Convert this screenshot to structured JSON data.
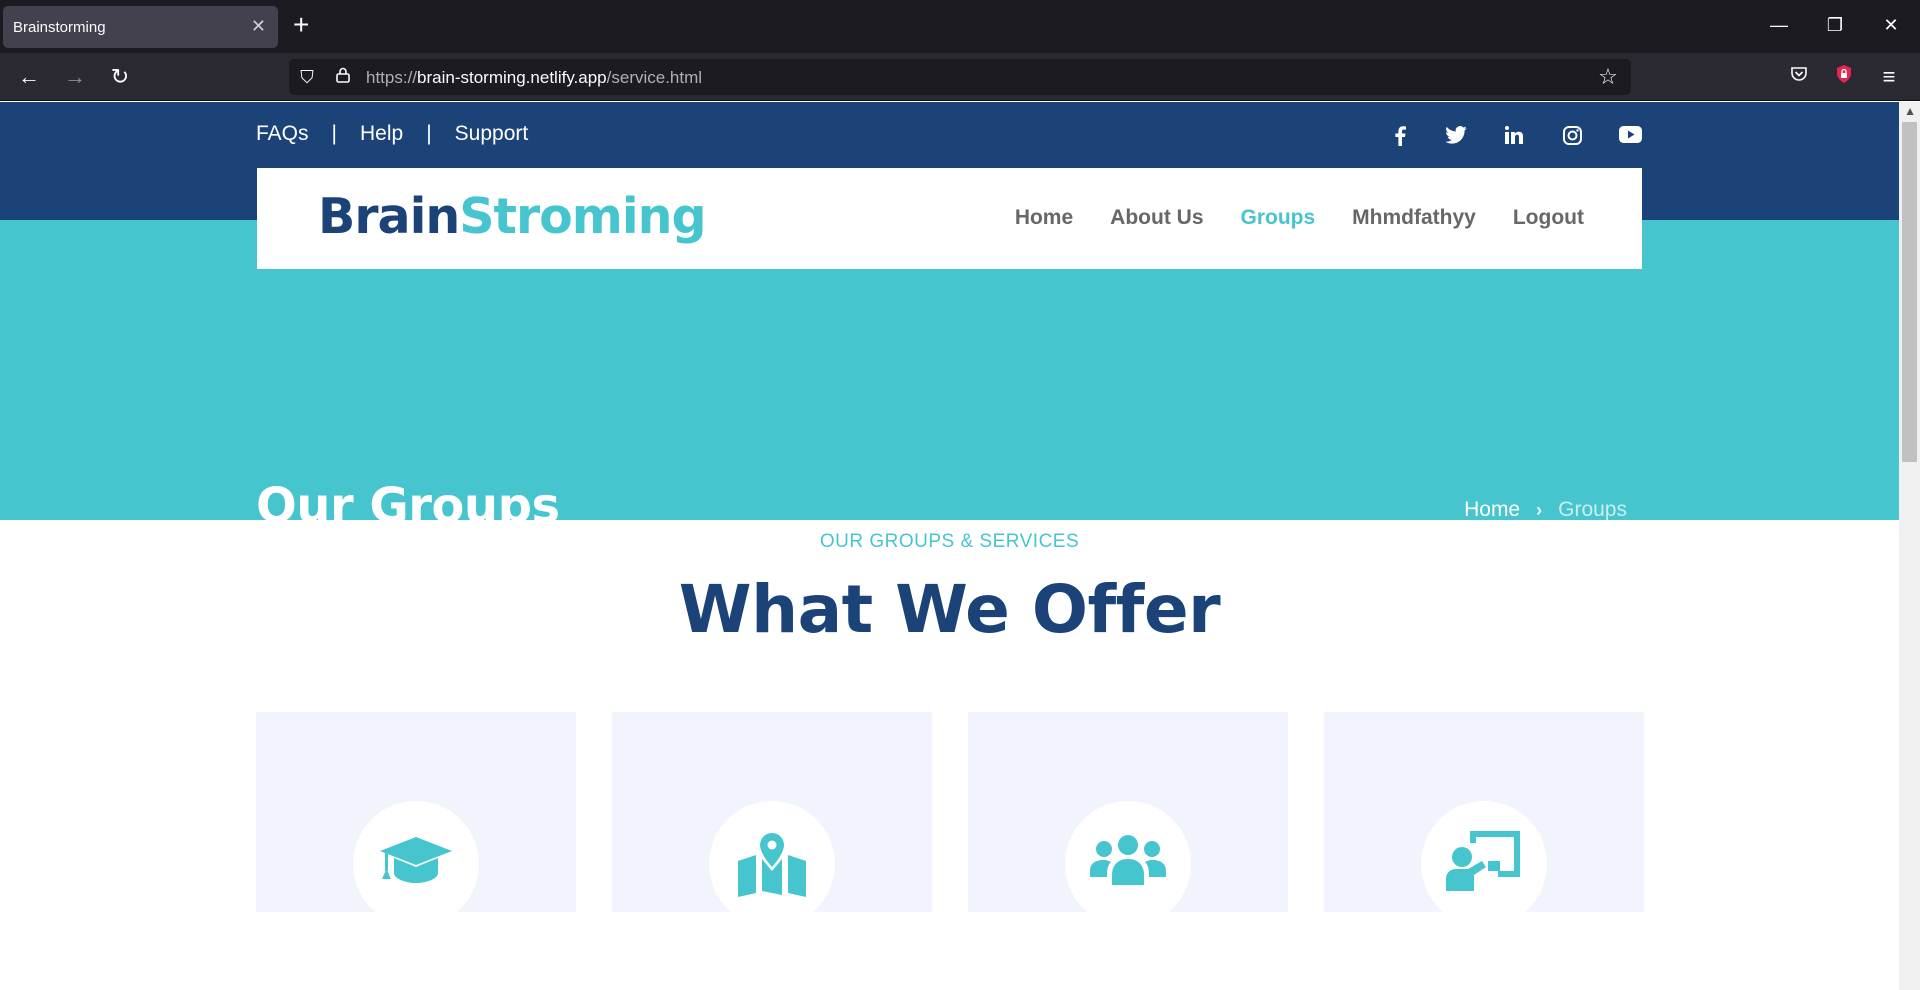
{
  "browser": {
    "tab_title": "Brainstorming",
    "url_scheme": "https://",
    "url_host": "brain-storming.netlify.app",
    "url_path": "/service.html"
  },
  "topbar": {
    "links": [
      "FAQs",
      "Help",
      "Support"
    ],
    "separator": "|",
    "social_icons": [
      "facebook-icon",
      "twitter-icon",
      "linkedin-icon",
      "instagram-icon",
      "youtube-icon"
    ]
  },
  "header": {
    "logo_part1": "Brain",
    "logo_part2": "Stroming",
    "menu": [
      {
        "label": "Home",
        "active": false
      },
      {
        "label": "About Us",
        "active": false
      },
      {
        "label": "Groups",
        "active": true
      },
      {
        "label": "Mhmdfathyy",
        "active": false
      },
      {
        "label": "Logout",
        "active": false
      }
    ]
  },
  "hero": {
    "title": "Our Groups",
    "breadcrumb_home": "Home",
    "breadcrumb_current": "Groups"
  },
  "section": {
    "subtitle": "OUR GROUPS & SERVICES",
    "title": "What We Offer"
  },
  "cards": [
    {
      "icon": "graduation-cap-icon"
    },
    {
      "icon": "map-marker-icon"
    },
    {
      "icon": "users-icon"
    },
    {
      "icon": "chalkboard-teacher-icon"
    }
  ],
  "colors": {
    "navy": "#1b4378",
    "teal": "#46c5cf",
    "card_bg": "#f1f4fd"
  }
}
